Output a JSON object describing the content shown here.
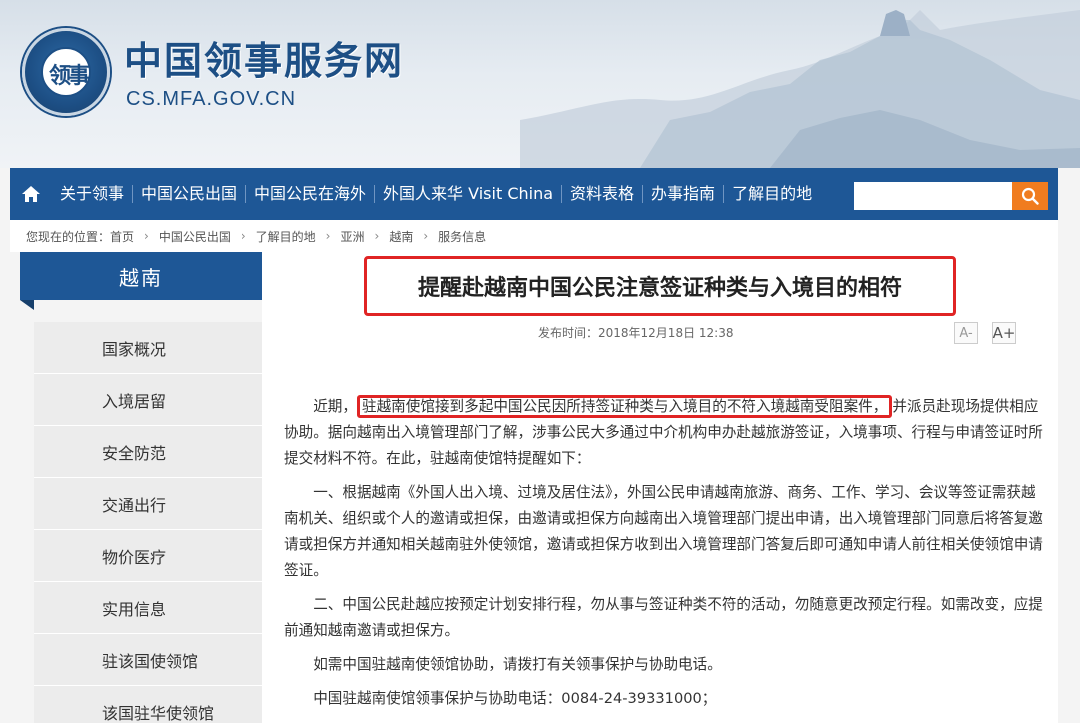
{
  "site": {
    "title": "中国领事服务网",
    "domain": "CS.MFA.GOV.CN",
    "seal_text": "领事"
  },
  "nav": {
    "items": [
      "关于领事",
      "中国公民出国",
      "中国公民在海外",
      "外国人来华 Visit China",
      "资料表格",
      "办事指南",
      "了解目的地"
    ],
    "search_placeholder": ""
  },
  "breadcrumb": {
    "prefix": "您现在的位置：首页",
    "crumbs": [
      "中国公民出国",
      "了解目的地",
      "亚洲",
      "越南",
      "服务信息"
    ]
  },
  "sidebar": {
    "title": "越南",
    "items": [
      "国家概况",
      "入境居留",
      "安全防范",
      "交通出行",
      "物价医疗",
      "实用信息",
      "驻该国使领馆",
      "该国驻华使领馆"
    ]
  },
  "article": {
    "title": "提醒赴越南中国公民注意签证种类与入境目的相符",
    "pubtime": "发布时间：2018年12月18日 12:38",
    "font_small": "A-",
    "font_large": "A+",
    "p1_before": "近期，",
    "p1_highlight": "驻越南使馆接到多起中国公民因所持签证种类与入境目的不符入境越南受阻案件，",
    "p1_after": "并派员赴现场提供相应协助。据向越南出入境管理部门了解，涉事公民大多通过中介机构申办赴越旅游签证，入境事项、行程与申请签证时所提交材料不符。在此，驻越南使馆特提醒如下：",
    "p2": "一、根据越南《外国人出入境、过境及居住法》，外国公民申请越南旅游、商务、工作、学习、会议等签证需获越南机关、组织或个人的邀请或担保，由邀请或担保方向越南出入境管理部门提出申请，出入境管理部门同意后将答复邀请或担保方并通知相关越南驻外使领馆，邀请或担保方收到出入境管理部门答复后即可通知申请人前往相关使领馆申请签证。",
    "p3": "二、中国公民赴越应按预定计划安排行程，勿从事与签证种类不符的活动，勿随意更改预定行程。如需改变，应提前通知越南邀请或担保方。",
    "p4": "如需中国驻越南使领馆协助，请拨打有关领事保护与协助电话。",
    "p5": "中国驻越南使馆领事保护与协助电话：0084-24-39331000；"
  },
  "colors": {
    "nav_bg": "#1e5796",
    "search_btn": "#f07c1f",
    "highlight_border": "#e02424"
  }
}
